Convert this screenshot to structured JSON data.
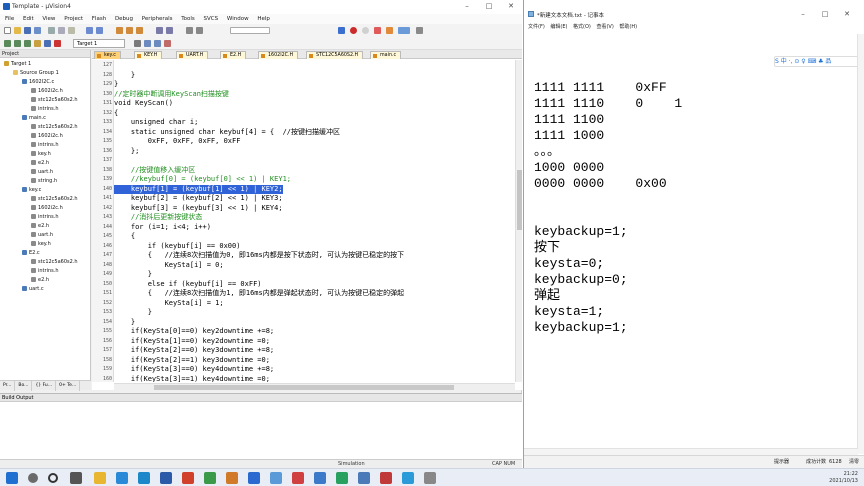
{
  "keil": {
    "title": "Template - µVision4",
    "menu": [
      "File",
      "Edit",
      "View",
      "Project",
      "Flash",
      "Debug",
      "Peripherals",
      "Tools",
      "SVCS",
      "Window",
      "Help"
    ],
    "target": "Target 1",
    "tabs": [
      "key.c",
      "KEY.H",
      "UART.H",
      "E2.H",
      "1602I2C.H",
      "STC12C5A60S2.H",
      "main.c"
    ],
    "project_panel_title": "Project",
    "project_tabs": [
      "Pr...",
      "Bo...",
      "{} Fu...",
      "0+ Te..."
    ],
    "tree": [
      {
        "label": "Target 1",
        "level": 0
      },
      {
        "label": "Source Group 1",
        "level": 1
      },
      {
        "label": "1602I2C.c",
        "level": 2
      },
      {
        "label": "1602i2c.h",
        "level": 3
      },
      {
        "label": "stc12c5a60s2.h",
        "level": 3
      },
      {
        "label": "intrins.h",
        "level": 3
      },
      {
        "label": "main.c",
        "level": 2
      },
      {
        "label": "stc12c5a60s2.h",
        "level": 3
      },
      {
        "label": "1602i2c.h",
        "level": 3
      },
      {
        "label": "intrins.h",
        "level": 3
      },
      {
        "label": "key.h",
        "level": 3
      },
      {
        "label": "e2.h",
        "level": 3
      },
      {
        "label": "uart.h",
        "level": 3
      },
      {
        "label": "string.h",
        "level": 3
      },
      {
        "label": "key.c",
        "level": 2
      },
      {
        "label": "stc12c5a60s2.h",
        "level": 3
      },
      {
        "label": "1602i2c.h",
        "level": 3
      },
      {
        "label": "intrins.h",
        "level": 3
      },
      {
        "label": "e2.h",
        "level": 3
      },
      {
        "label": "uart.h",
        "level": 3
      },
      {
        "label": "key.h",
        "level": 3
      },
      {
        "label": "E2.c",
        "level": 2
      },
      {
        "label": "stc12c5a60s2.h",
        "level": 3
      },
      {
        "label": "intrins.h",
        "level": 3
      },
      {
        "label": "e2.h",
        "level": 3
      },
      {
        "label": "uart.c",
        "level": 2
      }
    ],
    "code_lines": [
      {
        "n": "127",
        "t": ""
      },
      {
        "n": "128",
        "t": "    }"
      },
      {
        "n": "129",
        "t": "}"
      },
      {
        "n": "130",
        "t": "//定时器中断调用KeyScan扫描按键"
      },
      {
        "n": "131",
        "t": "void KeyScan()"
      },
      {
        "n": "132",
        "t": "{"
      },
      {
        "n": "133",
        "t": "    unsigned char i;"
      },
      {
        "n": "134",
        "t": "    static unsigned char keybuf[4] = {  //按键扫描缓冲区"
      },
      {
        "n": "135",
        "t": "        0xFF, 0xFF, 0xFF, 0xFF"
      },
      {
        "n": "136",
        "t": "    };"
      },
      {
        "n": "137",
        "t": ""
      },
      {
        "n": "138",
        "t": "    //按键值移入缓冲区"
      },
      {
        "n": "139",
        "t": "    //keybuf[0] = (keybuf[0] << 1) | KEY1;"
      },
      {
        "n": "140",
        "t": "    keybuf[1] = (keybuf[1] << 1) | KEY2;"
      },
      {
        "n": "141",
        "t": "    keybuf[2] = (keybuf[2] << 1) | KEY3;"
      },
      {
        "n": "142",
        "t": "    keybuf[3] = (keybuf[3] << 1) | KEY4;"
      },
      {
        "n": "143",
        "t": "    //消抖后更新按键状态"
      },
      {
        "n": "144",
        "t": "    for (i=1; i<4; i++)"
      },
      {
        "n": "145",
        "t": "    {"
      },
      {
        "n": "146",
        "t": "        if (keybuf[i] == 0x00)"
      },
      {
        "n": "147",
        "t": "        {   //连续8次扫描值为0, 即16ms内都是按下状态时, 可认为按键已稳定的按下"
      },
      {
        "n": "148",
        "t": "            KeySta[i] = 0;"
      },
      {
        "n": "149",
        "t": "        }"
      },
      {
        "n": "150",
        "t": "        else if (keybuf[i] == 0xFF)"
      },
      {
        "n": "151",
        "t": "        {   //连续8次扫描值为1, 即16ms内都是弹起状态时, 可认为按键已稳定的弹起"
      },
      {
        "n": "152",
        "t": "            KeySta[i] = 1;"
      },
      {
        "n": "153",
        "t": "        }"
      },
      {
        "n": "154",
        "t": "    }"
      },
      {
        "n": "155",
        "t": "    if(KeySta[0]==0) key2downtime +=8;"
      },
      {
        "n": "156",
        "t": "    if(KeySta[1]==0) key2downtime =0;"
      },
      {
        "n": "157",
        "t": "    if(KeySta[2]==0) key3downtime +=8;"
      },
      {
        "n": "158",
        "t": "    if(KeySta[2]==1) key3downtime =0;"
      },
      {
        "n": "159",
        "t": "    if(KeySta[3]==0) key4downtime +=8;"
      },
      {
        "n": "160",
        "t": "    if(KeySta[3]==1) key4downtime =0;"
      }
    ],
    "build_output_title": "Build Output",
    "status": "Simulation",
    "status_right": "CAP  NUM"
  },
  "notepad": {
    "title": "*新建文本文档.txt - 记事本",
    "menu": [
      "文件(F)",
      "编辑(E)",
      "格式(O)",
      "查看(V)",
      "帮助(H)"
    ],
    "ime": "S 中 ·, ⊙ ♀ ⌨ ♣ 品",
    "lines": [
      "1111 1111    0xFF",
      "1111 1110    0    1",
      "1111 1100",
      "1111 1000",
      "。。。",
      "1000 0000",
      "0000 0000    0x00",
      "",
      "",
      "keybackup=1;",
      "按下",
      "keysta=0;",
      "keybackup=0;",
      "弹起",
      "keysta=1;",
      "keybackup=1;"
    ],
    "status_left": "提示器",
    "status_mid": "成功计数",
    "status_num": "6128",
    "status_right": "清零"
  },
  "taskbar": {
    "time": "21:22",
    "date": "2021/10/13"
  },
  "colors": {
    "keyword": "#0000c8",
    "comment": "#1f8f1f",
    "selection": "#3062d8",
    "tab_active": "#ffd27a"
  }
}
